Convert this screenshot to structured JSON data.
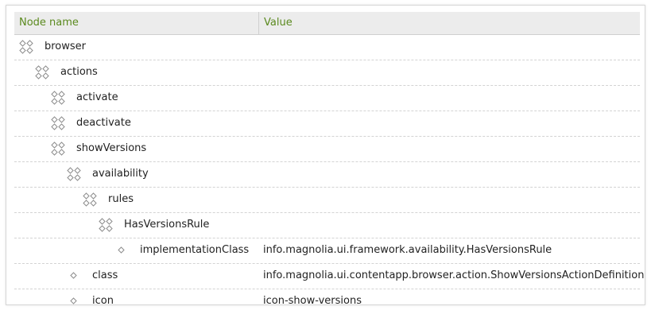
{
  "columns": {
    "name": "Node name",
    "value": "Value"
  },
  "colors": {
    "header_text": "#5b8a1f",
    "header_bg": "#ececec",
    "icon": "#8c8c8c"
  },
  "rows": [
    {
      "name": "browser",
      "value": "",
      "depth": 0,
      "icon": "folder-node-icon"
    },
    {
      "name": "actions",
      "value": "",
      "depth": 1,
      "icon": "folder-node-icon"
    },
    {
      "name": "activate",
      "value": "",
      "depth": 2,
      "icon": "folder-node-icon"
    },
    {
      "name": "deactivate",
      "value": "",
      "depth": 2,
      "icon": "folder-node-icon"
    },
    {
      "name": "showVersions",
      "value": "",
      "depth": 2,
      "icon": "folder-node-icon"
    },
    {
      "name": "availability",
      "value": "",
      "depth": 3,
      "icon": "folder-node-icon"
    },
    {
      "name": "rules",
      "value": "",
      "depth": 4,
      "icon": "folder-node-icon"
    },
    {
      "name": "HasVersionsRule",
      "value": "",
      "depth": 5,
      "icon": "folder-node-icon"
    },
    {
      "name": "implementationClass",
      "value": "info.magnolia.ui.framework.availability.HasVersionsRule",
      "depth": 6,
      "icon": "property-icon"
    },
    {
      "name": "class",
      "value": "info.magnolia.ui.contentapp.browser.action.ShowVersionsActionDefinition",
      "depth": 3,
      "icon": "property-icon"
    },
    {
      "name": "icon",
      "value": "icon-show-versions",
      "depth": 3,
      "icon": "property-icon"
    }
  ]
}
